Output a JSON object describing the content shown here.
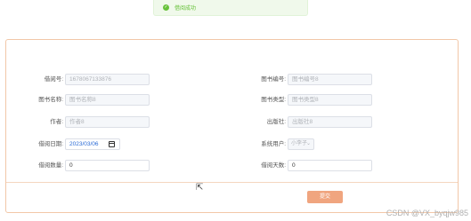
{
  "toast": {
    "icon": "check-icon",
    "text": "借阅成功",
    "color": "#67c23a"
  },
  "form": {
    "fields": [
      {
        "label": "借阅号:",
        "value": "1678067133876",
        "kind": "readonly"
      },
      {
        "label": "图书编号:",
        "value": "图书编号8",
        "kind": "readonly"
      },
      {
        "label": "图书名称:",
        "value": "图书名称8",
        "kind": "readonly"
      },
      {
        "label": "图书类型:",
        "value": "图书类型8",
        "kind": "readonly"
      },
      {
        "label": "作者:",
        "value": "作者8",
        "kind": "readonly"
      },
      {
        "label": "出版社:",
        "value": "出版社8",
        "kind": "readonly"
      },
      {
        "label": "借阅日期:",
        "value": "2023/03/06",
        "kind": "date"
      },
      {
        "label": "系统用户:",
        "value": "小李子",
        "kind": "select"
      },
      {
        "label": "借阅数量:",
        "value": "0",
        "kind": "input"
      },
      {
        "label": "借阅天数:",
        "value": "0",
        "kind": "input"
      }
    ],
    "submit_label": "提交",
    "accent": "#f0a57f"
  },
  "watermark": "CSDN @VX_byqjw985"
}
